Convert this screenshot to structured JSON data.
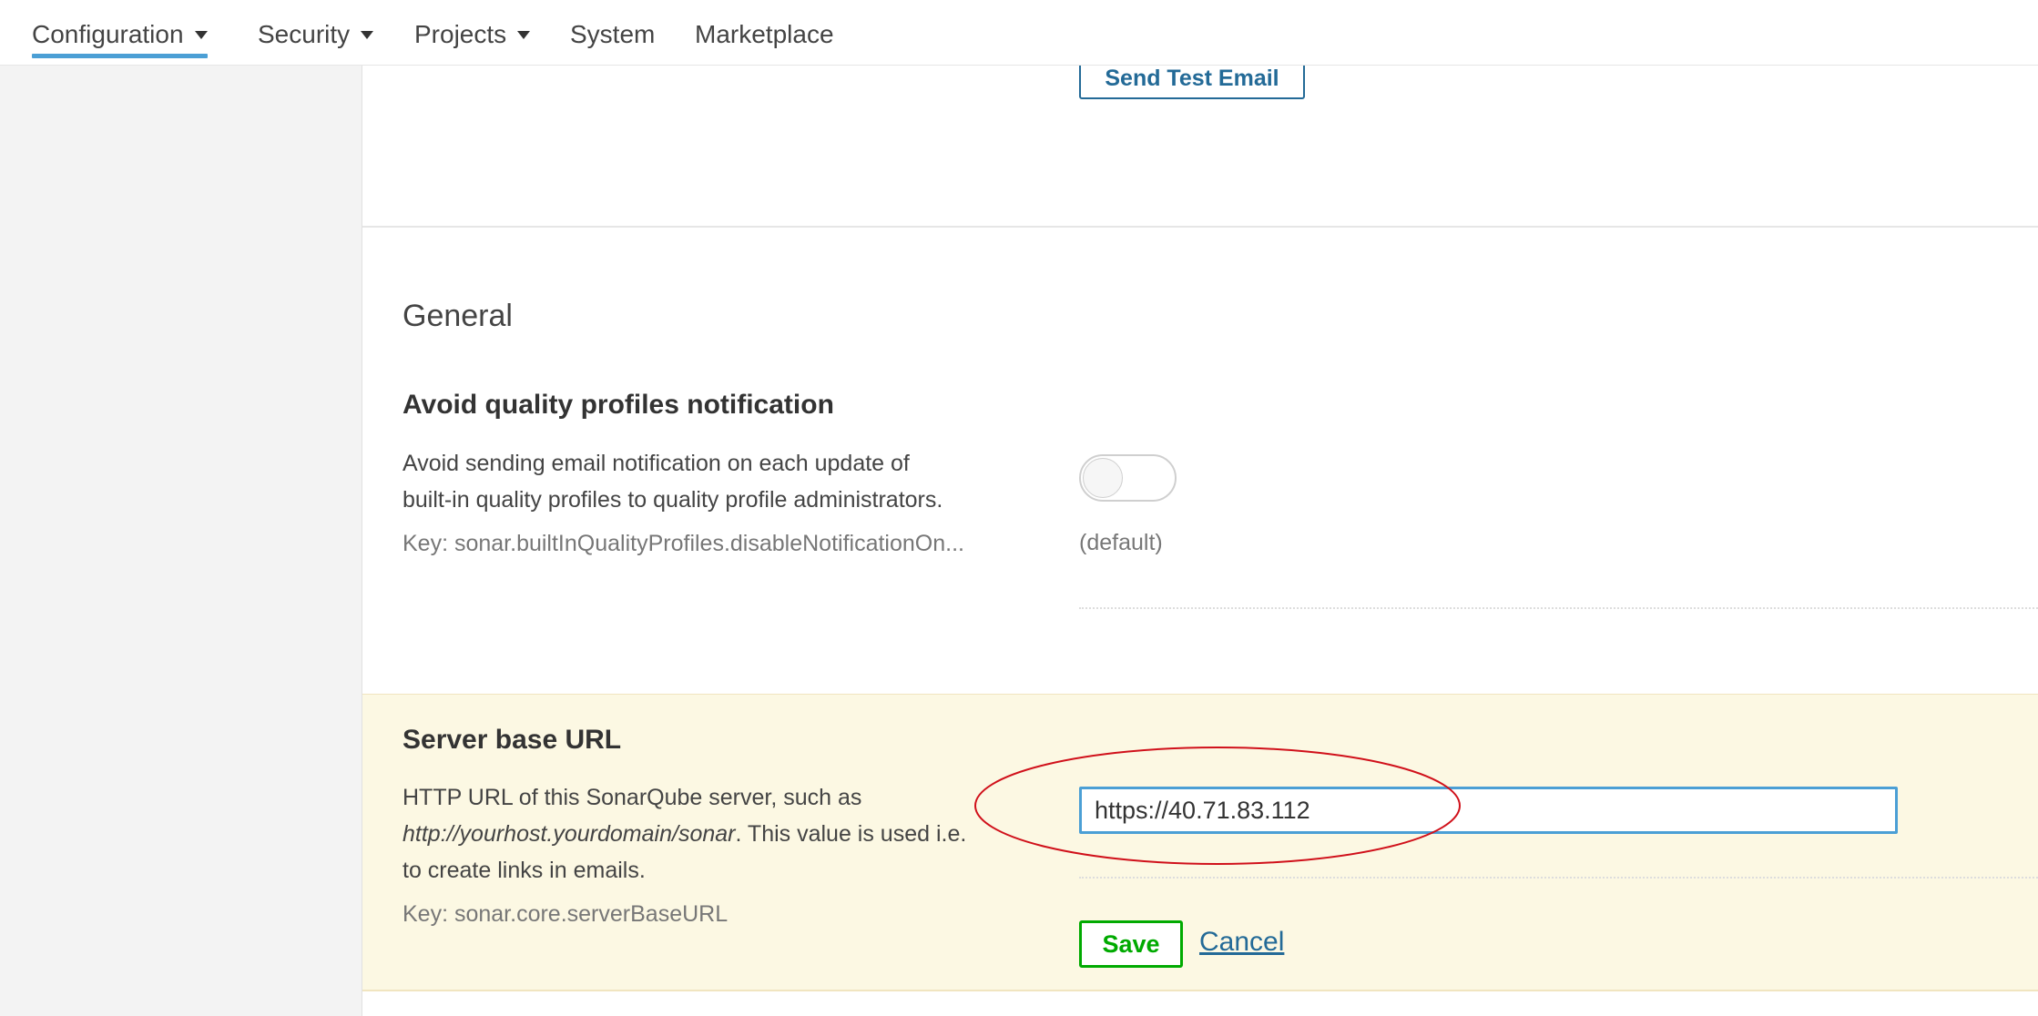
{
  "nav": {
    "items": [
      {
        "label": "Configuration",
        "dropdown": true,
        "active": true
      },
      {
        "label": "Security",
        "dropdown": true
      },
      {
        "label": "Projects",
        "dropdown": true
      },
      {
        "label": "System",
        "dropdown": false
      },
      {
        "label": "Marketplace",
        "dropdown": false
      }
    ]
  },
  "email": {
    "send_test_label": "Send Test Email"
  },
  "general": {
    "title": "General",
    "quality_profiles": {
      "title": "Avoid quality profiles notification",
      "desc_line1": "Avoid sending email notification on each update of",
      "desc_line2": "built-in quality profiles to quality profile administrators.",
      "key": "Key: sonar.builtInQualityProfiles.disableNotificationOn...",
      "toggle_on": false,
      "default_note": "(default)"
    },
    "server_base_url": {
      "title": "Server base URL",
      "desc_pre": "HTTP URL of this SonarQube server, such as",
      "desc_example": "http://yourhost.yourdomain/sonar",
      "desc_mid": ". This value is used i.e.",
      "desc_end": "to create links in emails.",
      "key": "Key: sonar.core.serverBaseURL",
      "value": "https://40.71.83.112",
      "save_label": "Save",
      "cancel_label": "Cancel"
    }
  },
  "colors": {
    "accent_blue": "#4b9fd5",
    "link_blue": "#236a97",
    "save_green": "#00aa00",
    "highlight_bg": "#fcf8e3",
    "annotation_red": "#d0101a"
  }
}
